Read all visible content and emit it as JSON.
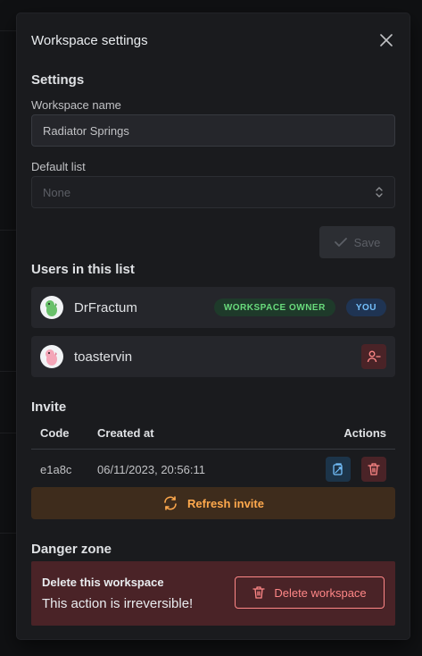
{
  "modal": {
    "title": "Workspace settings"
  },
  "settings": {
    "heading": "Settings",
    "name_label": "Workspace name",
    "name_value": "Radiator Springs",
    "list_label": "Default list",
    "list_value": "None",
    "save_label": "Save"
  },
  "users": {
    "heading": "Users in this list",
    "items": [
      {
        "name": "DrFractum",
        "badges": [
          "WORKSPACE OWNER",
          "YOU"
        ]
      },
      {
        "name": "toastervin",
        "badges": []
      }
    ]
  },
  "invite": {
    "heading": "Invite",
    "columns": [
      "Code",
      "Created at",
      "Actions"
    ],
    "rows": [
      {
        "code": "e1a8c",
        "created_at": "06/11/2023, 20:56:11"
      }
    ],
    "refresh_label": "Refresh invite"
  },
  "danger": {
    "heading": "Danger zone",
    "title": "Delete this workspace",
    "text": "This action is irreversible!",
    "button_label": "Delete workspace"
  },
  "colors": {
    "accent_orange": "#ffa94d",
    "danger_red": "#ff8787",
    "owner_green": "#69db7c",
    "you_blue": "#74c0fc"
  }
}
